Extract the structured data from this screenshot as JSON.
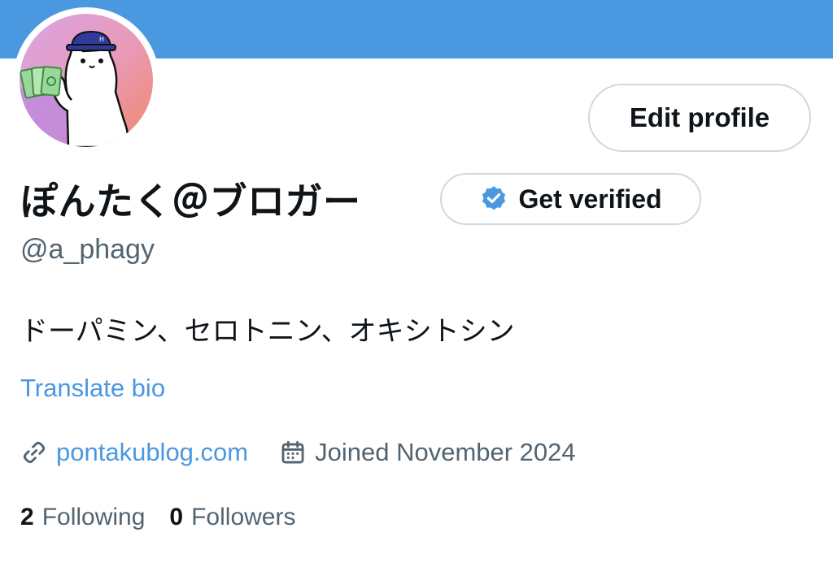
{
  "profile": {
    "display_name": "ぽんたく＠ブロガー",
    "handle": "@a_phagy",
    "bio": "ドーパミン、セロトニン、オキシトシン",
    "translate_label": "Translate bio",
    "website": "pontakublog.com",
    "joined": "Joined November 2024",
    "following_count": "2",
    "following_label": "Following",
    "followers_count": "0",
    "followers_label": "Followers"
  },
  "actions": {
    "edit_profile_label": "Edit profile",
    "get_verified_label": "Get verified"
  },
  "icons": {
    "verified": "verified-badge-icon",
    "link": "link-icon",
    "calendar": "calendar-icon"
  },
  "colors": {
    "banner": "#4a98e0",
    "accent": "#4a98e0",
    "secondary_text": "#536471",
    "border": "#cfd9de"
  }
}
